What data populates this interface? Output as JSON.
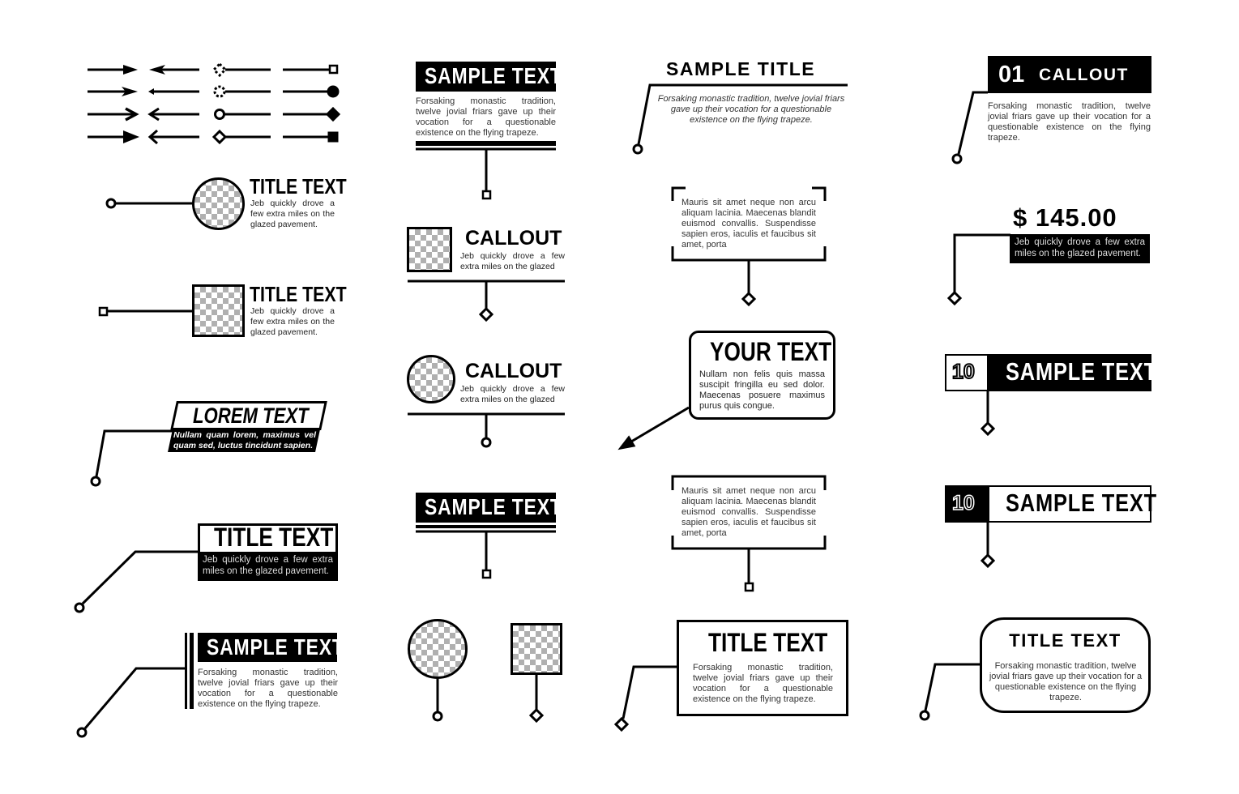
{
  "palette": {
    "ink": "#000000",
    "paper": "#ffffff",
    "placeholder": "#b0b0b0",
    "body_text": "#333333"
  },
  "arrow_styles": {
    "rows": 4,
    "columns": [
      "arrow-right",
      "arrow-left",
      "dot-end-left",
      "cap-end-right"
    ],
    "end_caps_left": [
      "dotted-diamond",
      "dotted-circle",
      "open-circle",
      "open-diamond"
    ],
    "end_caps_right": [
      "open-square",
      "filled-circle",
      "filled-diamond",
      "filled-square"
    ]
  },
  "col1": {
    "circle_callout": {
      "title": "TITLE TEXT",
      "body": "Jeb quickly drove a few extra miles on the glazed pavement.",
      "marker": "open-circle"
    },
    "square_callout": {
      "title": "TITLE TEXT",
      "body": "Jeb quickly drove a few extra miles on the glazed pavement.",
      "marker": "open-square"
    },
    "lorem_callout": {
      "title": "LOREM TEXT",
      "body": "Nullam quam lorem, maximus vel quam sed, luctus tincidunt sapien.",
      "marker": "open-circle"
    },
    "title_callout": {
      "title": "TITLE TEXT",
      "body": "Jeb quickly drove a few extra miles on the glazed pavement.",
      "marker": "open-circle"
    },
    "sample_callout": {
      "title": "SAMPLE TEXT",
      "body": "Forsaking monastic tradition, twelve jovial friars gave up their vocation for a questionable existence on the flying trapeze.",
      "marker": "open-circle"
    }
  },
  "col2": {
    "sample_top": {
      "title": "SAMPLE TEXT",
      "body": "Forsaking monastic tradition, twelve jovial friars gave up their vocation for a questionable existence on the flying trapeze.",
      "marker": "open-square"
    },
    "callout_square": {
      "title": "CALLOUT",
      "body": "Jeb quickly drove a few extra miles on the glazed",
      "marker": "open-diamond"
    },
    "callout_circle": {
      "title": "CALLOUT",
      "body": "Jeb quickly drove a few extra miles on the glazed",
      "marker": "open-circle"
    },
    "sample_bottom": {
      "title": "SAMPLE TEXT",
      "marker": "open-square"
    },
    "pin_circle": {
      "marker": "open-circle"
    },
    "pin_square": {
      "marker": "open-diamond"
    }
  },
  "col3": {
    "sample_title": {
      "title": "SAMPLE TITLE",
      "body": "Forsaking monastic tradition, twelve jovial friars gave up their vocation for a questionable existence on the flying trapeze.",
      "marker": "open-circle"
    },
    "bracket_top": {
      "body": "Mauris sit amet neque non arcu aliquam lacinia. Maecenas blandit euismod convallis. Suspendisse sapien eros, iaculis et faucibus sit amet, porta",
      "marker": "open-diamond"
    },
    "your_text": {
      "title": "YOUR TEXT",
      "body": "Nullam non felis quis massa suscipit fringilla eu sed dolor. Maecenas posuere maximus purus quis congue.",
      "marker": "arrow"
    },
    "bracket_bottom": {
      "body": "Mauris sit amet neque non arcu aliquam lacinia. Maecenas blandit euismod convallis. Suspendisse sapien eros, iaculis et faucibus sit amet, porta",
      "marker": "open-square"
    },
    "title_box": {
      "title": "TITLE TEXT",
      "body": "Forsaking monastic tradition, twelve jovial friars gave up their vocation for a questionable existence on the flying trapeze.",
      "marker": "open-diamond"
    }
  },
  "col4": {
    "numbered_callout": {
      "number": "01",
      "title": "CALLOUT",
      "body": "Forsaking monastic tradition, twelve jovial friars gave up their vocation for a questionable existence on the flying trapeze.",
      "marker": "open-circle"
    },
    "price_callout": {
      "price": "$ 145.00",
      "body": "Jeb quickly drove a few extra miles on the glazed pavement.",
      "marker": "open-diamond"
    },
    "numbered_dark": {
      "number": "10",
      "title": "SAMPLE TEXT",
      "marker": "open-diamond"
    },
    "numbered_light": {
      "number": "10",
      "title": "SAMPLE TEXT",
      "marker": "open-diamond"
    },
    "rounded_title": {
      "title": "TITLE TEXT",
      "body": "Forsaking monastic tradition, twelve jovial friars gave up their vocation for a questionable existence on the flying trapeze.",
      "marker": "open-circle"
    }
  }
}
